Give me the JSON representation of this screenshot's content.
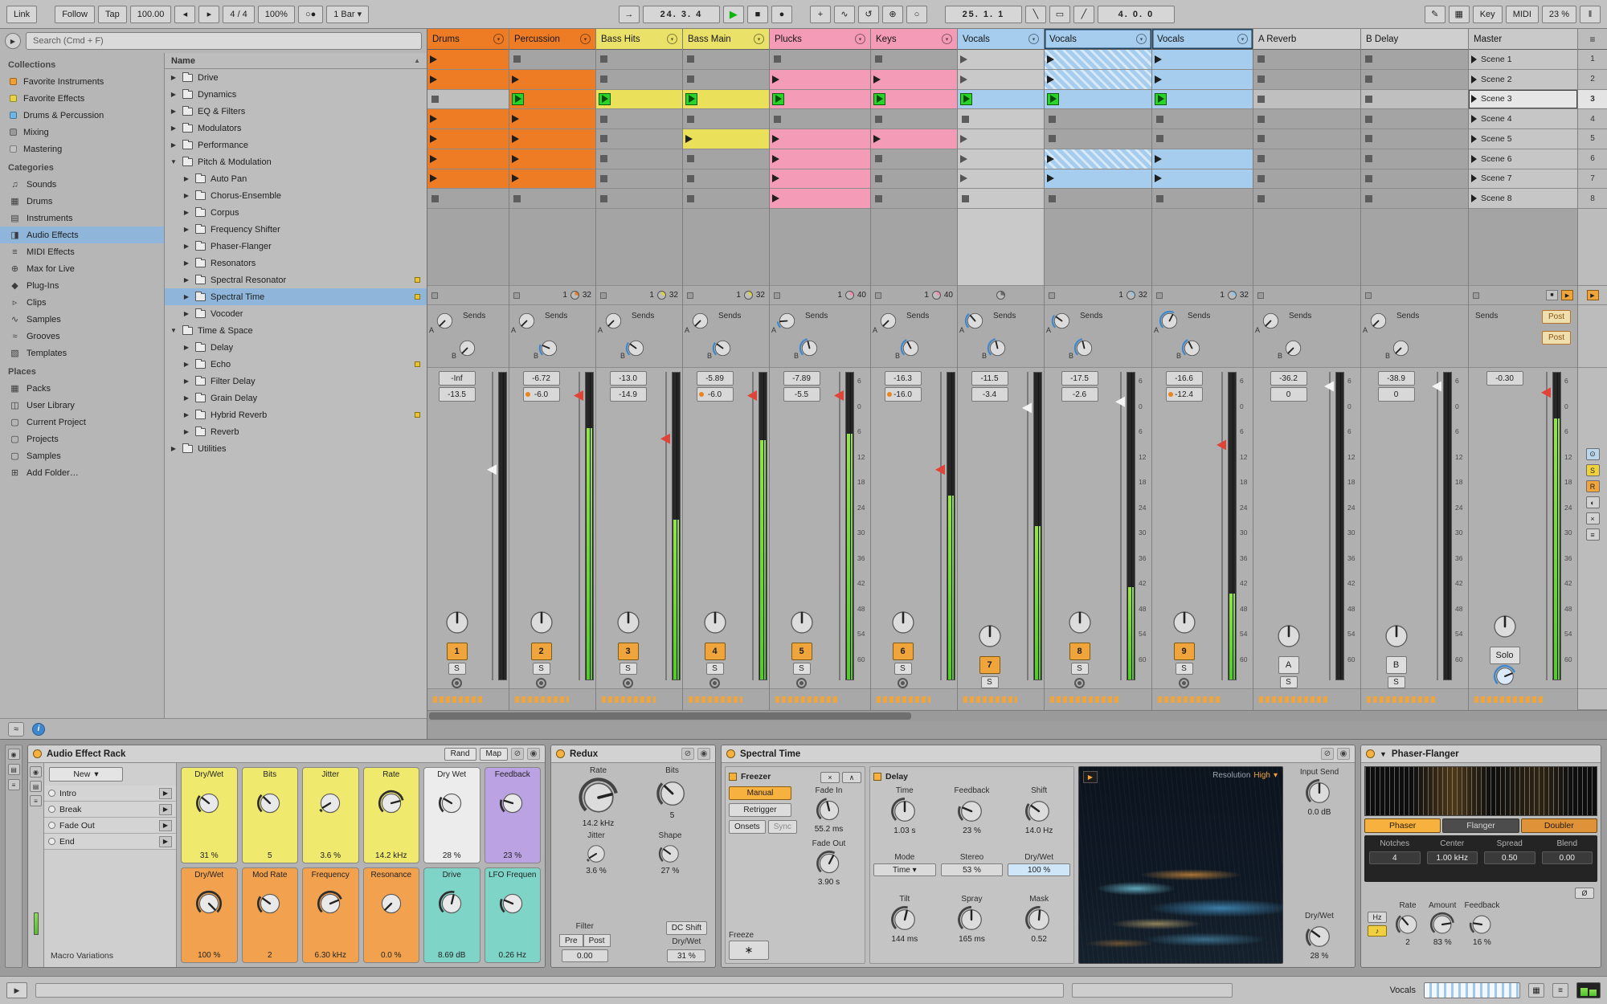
{
  "icons": {
    "menu_arrow": "▾",
    "swap": "⊘",
    "save": "◉",
    "tri_right": "▶",
    "tri_down": "▼",
    "sort_arrow": "▲",
    "hamburger": "≡"
  },
  "toolbar": {
    "link": "Link",
    "follow": "Follow",
    "tap": "Tap",
    "tempo": "100.00",
    "nudge_down": "◂",
    "nudge_up": "▸",
    "time_sig": "4 / 4",
    "groove_amount": "100%",
    "metronome": "○●",
    "quantize_menu": "1 Bar",
    "follow_icon": "→",
    "position": "24.  3.  4",
    "play": "▶",
    "stop": "■",
    "record": "●",
    "overdub": "+",
    "automation_arm": "∿",
    "reenable": "↺",
    "capture": "⊕",
    "session_record": "○",
    "punch_in_pos": "25.  1.  1",
    "punch_in_icon": "╲",
    "loop_icon": "▭",
    "punch_out_icon": "╱",
    "loop_length": "4.  0.  0",
    "draw_icon": "✎",
    "keyboard_icon": "▦",
    "key": "Key",
    "midi": "MIDI",
    "cpu": "23 %",
    "meter_icon": "‖"
  },
  "browser": {
    "search_placeholder": "Search (Cmd + F)",
    "sections": [
      {
        "title": "Collections",
        "items": [
          {
            "label": "Favorite Instruments",
            "swatch": "#f0a030"
          },
          {
            "label": "Favorite Effects",
            "swatch": "#e8d443"
          },
          {
            "label": "Drums & Percussion",
            "swatch": "#6cb6e8"
          },
          {
            "label": "Mixing",
            "swatch": "#9a9a9a"
          },
          {
            "label": "Mastering",
            "swatch": "#c2c2c2"
          }
        ]
      },
      {
        "title": "Categories",
        "items": [
          {
            "label": "Sounds",
            "glyph": "♫"
          },
          {
            "label": "Drums",
            "glyph": "▦"
          },
          {
            "label": "Instruments",
            "glyph": "▤"
          },
          {
            "label": "Audio Effects",
            "glyph": "◨",
            "selected": true
          },
          {
            "label": "MIDI Effects",
            "glyph": "≡"
          },
          {
            "label": "Max for Live",
            "glyph": "⊕"
          },
          {
            "label": "Plug-Ins",
            "glyph": "◆"
          },
          {
            "label": "Clips",
            "glyph": "▹"
          },
          {
            "label": "Samples",
            "glyph": "∿"
          },
          {
            "label": "Grooves",
            "glyph": "≈"
          },
          {
            "label": "Templates",
            "glyph": "▧"
          }
        ]
      },
      {
        "title": "Places",
        "items": [
          {
            "label": "Packs",
            "glyph": "▦"
          },
          {
            "label": "User Library",
            "glyph": "◫"
          },
          {
            "label": "Current Project",
            "glyph": "▢"
          },
          {
            "label": "Projects",
            "glyph": "▢"
          },
          {
            "label": "Samples",
            "glyph": "▢"
          },
          {
            "label": "Add Folder…",
            "glyph": "⊞"
          }
        ]
      }
    ],
    "file_list": {
      "header": "Name",
      "items": [
        {
          "label": "Drive",
          "depth": 0
        },
        {
          "label": "Dynamics",
          "depth": 0
        },
        {
          "label": "EQ & Filters",
          "depth": 0
        },
        {
          "label": "Modulators",
          "depth": 0
        },
        {
          "label": "Performance",
          "depth": 0
        },
        {
          "label": "Pitch & Modulation",
          "depth": 0,
          "expanded": true
        },
        {
          "label": "Auto Pan",
          "depth": 1
        },
        {
          "label": "Chorus-Ensemble",
          "depth": 1
        },
        {
          "label": "Corpus",
          "depth": 1
        },
        {
          "label": "Frequency Shifter",
          "depth": 1
        },
        {
          "label": "Phaser-Flanger",
          "depth": 1
        },
        {
          "label": "Resonators",
          "depth": 1
        },
        {
          "label": "Spectral Resonator",
          "depth": 1,
          "dot": true
        },
        {
          "label": "Spectral Time",
          "depth": 1,
          "selected": true,
          "dot": true
        },
        {
          "label": "Vocoder",
          "depth": 1
        },
        {
          "label": "Time & Space",
          "depth": 0,
          "expanded": true
        },
        {
          "label": "Delay",
          "depth": 1
        },
        {
          "label": "Echo",
          "depth": 1,
          "dot": true
        },
        {
          "label": "Filter Delay",
          "depth": 1
        },
        {
          "label": "Grain Delay",
          "depth": 1
        },
        {
          "label": "Hybrid Reverb",
          "depth": 1,
          "dot": true
        },
        {
          "label": "Reverb",
          "depth": 1
        },
        {
          "label": "Utilities",
          "depth": 0
        }
      ]
    },
    "footer_icons": [
      {
        "name": "groove-pool-toggle",
        "glyph": "≈"
      },
      {
        "name": "info-toggle",
        "glyph": "i"
      }
    ]
  },
  "session": {
    "sends_label": "Sends",
    "menu_icon": "≡",
    "back_icon": "▶",
    "master_icons": {
      "stop_all": "■",
      "back": "▶"
    },
    "db_scale": [
      "6",
      "0",
      "6",
      "12",
      "18",
      "24",
      "30",
      "36",
      "42",
      "48",
      "54",
      "60"
    ],
    "selected_scene": 2,
    "scenes": [
      {
        "name": "Scene 1",
        "num": "1"
      },
      {
        "name": "Scene 2",
        "num": "2"
      },
      {
        "name": "Scene 3",
        "num": "3"
      },
      {
        "name": "Scene 4",
        "num": "4"
      },
      {
        "name": "Scene 5",
        "num": "5"
      },
      {
        "name": "Scene 6",
        "num": "6"
      },
      {
        "name": "Scene 7",
        "num": "7"
      },
      {
        "name": "Scene 8",
        "num": "8"
      }
    ],
    "mixer_toggles": [
      {
        "name": "io-section-toggle",
        "glyph": "⊙",
        "bg": "#bcd6ec"
      },
      {
        "name": "sends-section-toggle",
        "glyph": "S",
        "bg": "#f0d23c"
      },
      {
        "name": "returns-section-toggle",
        "glyph": "R",
        "bg": "#f0a43c"
      },
      {
        "name": "mixer-section-toggle",
        "glyph": "◐",
        "bg": "#d2d2d2"
      },
      {
        "name": "trackdelay-section-toggle",
        "glyph": "×",
        "bg": "#d2d2d2"
      },
      {
        "name": "crossfader-section-toggle",
        "glyph": "≡",
        "bg": "#d2d2d2"
      }
    ],
    "tracks": [
      {
        "name": "Drums",
        "color": "#ee7c25",
        "clip": "#ee7c25",
        "num": "1",
        "clips": [
          "play",
          "play",
          "stop",
          "play",
          "play",
          "play",
          "play",
          "stop"
        ],
        "counter": {
          "sq": true
        },
        "send_a": 0,
        "send_b": 0,
        "vol": "-Inf",
        "vol2": "-13.5",
        "vol2_dot": false,
        "meter": 0,
        "fader": 0.3,
        "handle": "white",
        "scale": false,
        "arm": true
      },
      {
        "name": "Percussion",
        "color": "#ee7c25",
        "clip": "#ee7c25",
        "num": "2",
        "clips": [
          "stop",
          "play",
          "playing",
          "play",
          "play",
          "play",
          "play",
          "stop"
        ],
        "counter": {
          "sq": true,
          "left": "1",
          "pie": "#e87c2c",
          "right": "32"
        },
        "send_a": 0,
        "send_b": 0.25,
        "vol": "-6.72",
        "vol2": "-6.0",
        "vol2_dot": true,
        "meter": 0.82,
        "fader": 0.06,
        "handle": "red",
        "scale": false,
        "arm": true
      },
      {
        "name": "Bass Hits",
        "color": "#eae268",
        "clip": "#eae05a",
        "num": "3",
        "clips": [
          "stop",
          "stop",
          "playing",
          "stop",
          "stop",
          "stop",
          "stop",
          "stop"
        ],
        "counter": {
          "sq": true,
          "left": "1",
          "pie": "#d8d23f",
          "right": "32"
        },
        "send_a": 0,
        "send_b": 0.3,
        "vol": "-13.0",
        "vol2": "-14.9",
        "vol2_dot": false,
        "meter": 0.52,
        "fader": 0.2,
        "handle": "red",
        "scale": false,
        "arm": true
      },
      {
        "name": "Bass Main",
        "color": "#eae268",
        "clip": "#eae05a",
        "num": "4",
        "clips": [
          "stop",
          "stop",
          "playing",
          "stop",
          "play",
          "stop",
          "stop",
          "stop"
        ],
        "counter": {
          "sq": true,
          "left": "1",
          "pie": "#d8d23f",
          "right": "32"
        },
        "send_a": 0,
        "send_b": 0.3,
        "vol": "-5.89",
        "vol2": "-6.0",
        "vol2_dot": true,
        "meter": 0.78,
        "fader": 0.06,
        "handle": "red",
        "scale": false,
        "arm": true
      },
      {
        "name": "Plucks",
        "color": "#f49cb7",
        "clip": "#f49cb7",
        "num": "5",
        "clips": [
          "stop",
          "play",
          "playing",
          "stop",
          "play",
          "play",
          "play",
          "play"
        ],
        "counter": {
          "sq": true,
          "left": "1",
          "pie": "#ef8fb0",
          "right": "40"
        },
        "send_a": 0.15,
        "send_b": 0.45,
        "vol": "-7.89",
        "vol2": "-5.5",
        "vol2_dot": false,
        "meter": 0.8,
        "fader": 0.06,
        "handle": "red",
        "scale": true,
        "arm": true
      },
      {
        "name": "Keys",
        "color": "#f49cb7",
        "clip": "#f49cb7",
        "num": "6",
        "clips": [
          "stop",
          "play",
          "playing",
          "stop",
          "play",
          "stop",
          "stop",
          "stop"
        ],
        "counter": {
          "sq": true,
          "left": "1",
          "pie": "#ef8fb0",
          "right": "40"
        },
        "send_a": 0,
        "send_b": 0.4,
        "vol": "-16.3",
        "vol2": "-16.0",
        "vol2_dot": true,
        "meter": 0.6,
        "fader": 0.3,
        "handle": "red",
        "scale": false,
        "arm": true
      },
      {
        "name": "Vocals",
        "color": "#a6cdee",
        "clip": "#a6cdee",
        "num": "7",
        "dim": true,
        "clips": [
          "play",
          "play",
          "playing",
          "stop",
          "play",
          "play",
          "play",
          "stop"
        ],
        "counter": {
          "pie": "#6a6a6a",
          "center": true
        },
        "send_a": 0.35,
        "send_b": 0.45,
        "vol": "-11.5",
        "vol2": "-3.4",
        "vol2_dot": false,
        "meter": 0.5,
        "fader": 0.1,
        "handle": "white",
        "scale": false,
        "arm": false
      },
      {
        "name": "Vocals",
        "color": "#a6cdee",
        "clip": "#a6cdee",
        "num": "8",
        "selected": true,
        "clips": [
          "hatch",
          "hatch",
          "playing",
          "stop",
          "stop",
          "hatch",
          "play",
          "stop"
        ],
        "counter": {
          "sq": true,
          "left": "1",
          "pie": "#8fc2ea",
          "right": "32"
        },
        "send_a": 0.3,
        "send_b": 0.45,
        "vol": "-17.5",
        "vol2": "-2.6",
        "vol2_dot": false,
        "meter": 0.3,
        "fader": 0.08,
        "handle": "white",
        "scale": true,
        "arm": true
      },
      {
        "name": "Vocals",
        "color": "#a6cdee",
        "clip": "#a6cdee",
        "num": "9",
        "selected": true,
        "clips": [
          "play",
          "play",
          "playing",
          "stop",
          "stop",
          "play",
          "play",
          "stop"
        ],
        "counter": {
          "sq": true,
          "left": "1",
          "pie": "#8fc2ea",
          "right": "32"
        },
        "send_a": 0.6,
        "send_b": 0.4,
        "vol": "-16.6",
        "vol2": "-12.4",
        "vol2_dot": true,
        "meter": 0.28,
        "fader": 0.22,
        "handle": "red",
        "scale": true,
        "arm": true
      },
      {
        "name": "A Reverb",
        "color": "#cfcfcf",
        "clip": "#cfcfcf",
        "num": "A",
        "num_plain": true,
        "clips": [
          "stop",
          "stop",
          "stop",
          "stop",
          "stop",
          "stop",
          "stop",
          "stop"
        ],
        "counter": {
          "sq": true
        },
        "send_a": 0,
        "send_b": 0,
        "vol": "-36.2",
        "vol2": "0",
        "vol2_dot": false,
        "meter": 0,
        "fader": 0.03,
        "handle": "white",
        "scale": true,
        "arm": false
      },
      {
        "name": "B Delay",
        "color": "#cfcfcf",
        "clip": "#cfcfcf",
        "num": "B",
        "num_plain": true,
        "clips": [
          "stop",
          "stop",
          "stop",
          "stop",
          "stop",
          "stop",
          "stop",
          "stop"
        ],
        "counter": {
          "sq": true
        },
        "send_a": 0,
        "send_b": 0,
        "vol": "-38.9",
        "vol2": "0",
        "vol2_dot": false,
        "meter": 0,
        "fader": 0.03,
        "handle": "white",
        "scale": true,
        "arm": false
      },
      {
        "name": "Master",
        "color": "#c9c9c9",
        "master": true,
        "counter": {
          "sq": true,
          "master": true
        },
        "vol": "-0.30",
        "solo_label": "Solo",
        "post_labels": [
          "Post",
          "Post"
        ],
        "meter": 0.85,
        "fader": 0.05,
        "handle": "red",
        "scale": true
      }
    ]
  },
  "devices": {
    "strip_icons": [
      {
        "name": "clip-view-toggle",
        "glyph": "◉"
      },
      {
        "name": "device-view-toggle",
        "glyph": "▤"
      },
      {
        "name": "chain-view-toggle",
        "glyph": "≡"
      }
    ],
    "rack": {
      "title": "Audio Effect Rack",
      "rand": "Rand",
      "map": "Map",
      "new_btn": "New",
      "chains": [
        "Intro",
        "Break",
        "Fade Out",
        "End"
      ],
      "variations": "Macro Variations",
      "macros": [
        {
          "name": "Dry/Wet",
          "value": "31 %",
          "color": "#efe96d",
          "frac": 0.31
        },
        {
          "name": "Bits",
          "value": "5",
          "color": "#efe96d",
          "frac": 0.33
        },
        {
          "name": "Jitter",
          "value": "3.6 %",
          "color": "#efe96d",
          "frac": 0.05
        },
        {
          "name": "Rate",
          "value": "14.2 kHz",
          "color": "#efe96d",
          "frac": 0.78
        },
        {
          "name": "Dry Wet",
          "value": "28 %",
          "color": "#ececec",
          "frac": 0.28
        },
        {
          "name": "Feedback",
          "value": "23 %",
          "color": "#bba2e3",
          "frac": 0.23
        },
        {
          "name": "Dry/Wet",
          "value": "100 %",
          "color": "#f2a24e",
          "frac": 1
        },
        {
          "name": "Mod Rate",
          "value": "2",
          "color": "#f2a24e",
          "frac": 0.3
        },
        {
          "name": "Frequency",
          "value": "6.30 kHz",
          "color": "#f2a24e",
          "frac": 0.75
        },
        {
          "name": "Resonance",
          "value": "0.0 %",
          "color": "#f2a24e",
          "frac": 0
        },
        {
          "name": "Drive",
          "value": "8.69 dB",
          "color": "#7fd4c8",
          "frac": 0.55
        },
        {
          "name": "LFO Frequen",
          "value": "0.26 Hz",
          "color": "#7fd4c8",
          "frac": 0.25
        }
      ]
    },
    "redux": {
      "title": "Redux",
      "rate_l": "Rate",
      "rate_v": "14.2 kHz",
      "bits_l": "Bits",
      "bits_v": "5",
      "jitter_l": "Jitter",
      "jitter_v": "3.6 %",
      "shape_l": "Shape",
      "shape_v": "27 %",
      "filter_l": "Filter",
      "pre": "Pre",
      "post": "Post",
      "filter_v": "0.00",
      "dc": "DC Shift",
      "dw_l": "Dry/Wet",
      "dw_v": "31 %"
    },
    "spectral": {
      "title": "Spectral Time",
      "freezer": "Freezer",
      "manual": "Manual",
      "retrigger": "Retrigger",
      "onsets": "Onsets",
      "sync": "Sync",
      "x_icon": "×",
      "arc_icon": "∧",
      "fade_in": "Fade In",
      "fade_in_v": "55.2 ms",
      "fade_out": "Fade Out",
      "fade_out_v": "3.90 s",
      "freeze": "Freeze",
      "freeze_icon": "∗",
      "delay": "Delay",
      "time": "Time",
      "time_v": "1.03 s",
      "feedback": "Feedback",
      "feedback_v": "23 %",
      "shift": "Shift",
      "shift_v": "14.0 Hz",
      "mode": "Mode",
      "mode_v": "Time",
      "stereo": "Stereo",
      "stereo_v": "53 %",
      "drywet": "Dry/Wet",
      "drywet_v": "100 %",
      "tilt": "Tilt",
      "tilt_v": "144 ms",
      "spray": "Spray",
      "spray_v": "165 ms",
      "mask": "Mask",
      "mask_v": "0.52",
      "resolution": "Resolution",
      "resolution_v": "High",
      "input_send": "Input Send",
      "input_send_v": "0.0 dB",
      "out_drywet": "Dry/Wet",
      "out_drywet_v": "28 %"
    },
    "phaser": {
      "title": "Phaser-Flanger",
      "tabs": [
        {
          "label": "Phaser",
          "variant": "amber"
        },
        {
          "label": "Flanger",
          "variant": "dark"
        },
        {
          "label": "Doubler",
          "variant": "amber2"
        }
      ],
      "notches": "Notches",
      "notches_v": "4",
      "center": "Center",
      "center_v": "1.00 kHz",
      "spread": "Spread",
      "spread_v": "0.50",
      "blend": "Blend",
      "blend_v": "0.00",
      "hz": "Hz",
      "note_icon": "♪",
      "rate": "Rate",
      "rate_v": "2",
      "amount": "Amount",
      "amount_v": "83 %",
      "feedback": "Feedback",
      "feedback_v": "16 %",
      "phase_icon": "Ø"
    },
    "knob_fracs": {
      "redux_rate": 0.78,
      "redux_bits": 0.33,
      "redux_jitter": 0.05,
      "redux_shape": 0.3,
      "st_fade_in": 0.45,
      "st_fade_out": 0.6,
      "st_time": 0.5,
      "st_feedback": 0.25,
      "st_shift": 0.3,
      "st_tilt": 0.55,
      "st_spray": 0.5,
      "st_mask": 0.52,
      "st_input": 0.5,
      "st_drywet": 0.3,
      "pf_rate": 0.35,
      "pf_amount": 0.8,
      "pf_feedback": 0.2
    }
  },
  "status_bar": {
    "play_icon": "▶",
    "track_label": "Vocals"
  }
}
